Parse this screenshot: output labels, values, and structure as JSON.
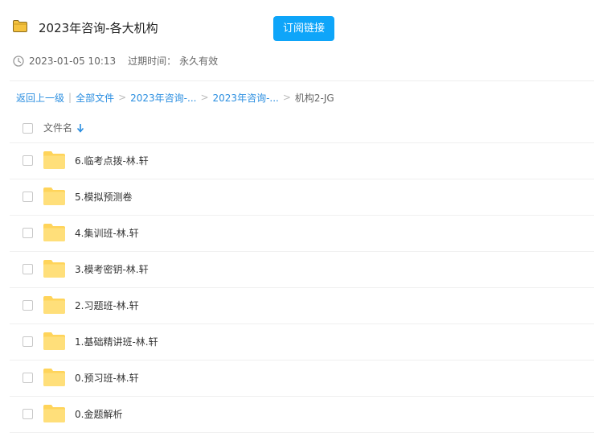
{
  "header": {
    "title": "2023年咨询-各大机构",
    "subscribe_label": "订阅链接",
    "created_time": "2023-01-05 10:13",
    "expire_label": "过期时间：",
    "expire_value": "永久有效",
    "accent_color": "#0ea5f9"
  },
  "breadcrumb": {
    "back_label": "返回上一级",
    "divider": "|",
    "items": [
      "全部文件",
      "2023年咨询-...",
      "2023年咨询-..."
    ],
    "separator": ">",
    "current": "机构2-JG"
  },
  "list": {
    "column_name_label": "文件名",
    "sort_icon": "arrow-down-icon",
    "folder_icon": "folder-icon",
    "folder_color": "#ffd45a",
    "items": [
      {
        "name": "6.临考点拨-林.轩"
      },
      {
        "name": "5.模拟预测卷"
      },
      {
        "name": "4.集训班-林.轩"
      },
      {
        "name": "3.模考密钥-林.轩"
      },
      {
        "name": "2.习题班-林.轩"
      },
      {
        "name": "1.基础精讲班-林.轩"
      },
      {
        "name": "0.预习班-林.轩"
      },
      {
        "name": "0.金题解析"
      }
    ]
  }
}
